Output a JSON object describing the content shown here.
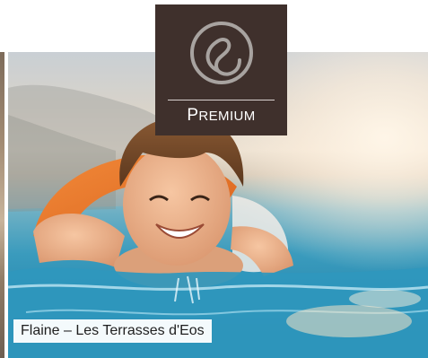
{
  "badge": {
    "first_letter": "P",
    "rest": "REMIUM",
    "icon": "premium-ampersand-icon",
    "bg_color": "#3f302c"
  },
  "card": {
    "title": "Flaine – Les Terrasses d'Eos",
    "photo": "photo-child-swimming-with-float"
  }
}
